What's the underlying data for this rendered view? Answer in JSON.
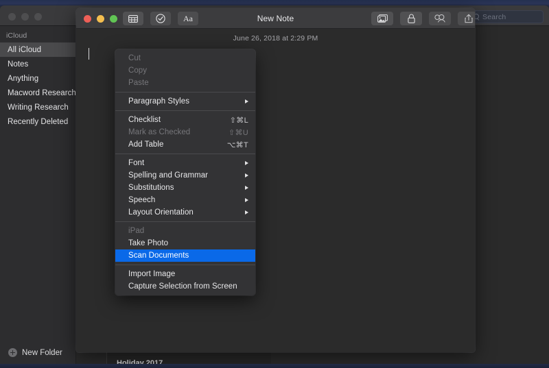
{
  "window_search": {
    "placeholder": "Search",
    "icon": "search-icon"
  },
  "sidebar": {
    "header": "iCloud",
    "items": [
      {
        "label": "All iCloud",
        "selected": true
      },
      {
        "label": "Notes",
        "selected": false
      },
      {
        "label": "Anything",
        "selected": false
      },
      {
        "label": "Macword Research",
        "selected": false
      },
      {
        "label": "Writing Research",
        "selected": false
      },
      {
        "label": "Recently Deleted",
        "selected": false
      }
    ],
    "new_folder_label": "New Folder",
    "new_folder_icon": "plus-circle-icon"
  },
  "notes_list": {
    "partial_note_title": "Holiday 2017"
  },
  "note_window": {
    "title": "New Note",
    "date": "June 26, 2018 at 2:29 PM",
    "body_text": "",
    "toolbar_left": [
      {
        "name": "table-button",
        "icon": "table-icon"
      },
      {
        "name": "checklist-button",
        "icon": "checkmark-circle-icon"
      },
      {
        "name": "format-button",
        "icon": "Aa"
      }
    ],
    "toolbar_right": [
      {
        "name": "media-button",
        "icon": "photo-icon"
      },
      {
        "name": "lock-button",
        "icon": "lock-icon"
      },
      {
        "name": "add-people-button",
        "icon": "add-person-icon"
      },
      {
        "name": "share-button",
        "icon": "share-icon"
      }
    ]
  },
  "context_menu": {
    "groups": [
      {
        "items": [
          {
            "label": "Cut",
            "shortcut": "",
            "disabled": true,
            "submenu": false,
            "highlighted": false
          },
          {
            "label": "Copy",
            "shortcut": "",
            "disabled": true,
            "submenu": false,
            "highlighted": false
          },
          {
            "label": "Paste",
            "shortcut": "",
            "disabled": true,
            "submenu": false,
            "highlighted": false
          }
        ]
      },
      {
        "items": [
          {
            "label": "Paragraph Styles",
            "shortcut": "",
            "disabled": false,
            "submenu": true,
            "highlighted": false
          }
        ]
      },
      {
        "items": [
          {
            "label": "Checklist",
            "shortcut": "⇧⌘L",
            "disabled": false,
            "submenu": false,
            "highlighted": false
          },
          {
            "label": "Mark as Checked",
            "shortcut": "⇧⌘U",
            "disabled": true,
            "submenu": false,
            "highlighted": false
          },
          {
            "label": "Add Table",
            "shortcut": "⌥⌘T",
            "disabled": false,
            "submenu": false,
            "highlighted": false
          }
        ]
      },
      {
        "items": [
          {
            "label": "Font",
            "shortcut": "",
            "disabled": false,
            "submenu": true,
            "highlighted": false
          },
          {
            "label": "Spelling and Grammar",
            "shortcut": "",
            "disabled": false,
            "submenu": true,
            "highlighted": false
          },
          {
            "label": "Substitutions",
            "shortcut": "",
            "disabled": false,
            "submenu": true,
            "highlighted": false
          },
          {
            "label": "Speech",
            "shortcut": "",
            "disabled": false,
            "submenu": true,
            "highlighted": false
          },
          {
            "label": "Layout Orientation",
            "shortcut": "",
            "disabled": false,
            "submenu": true,
            "highlighted": false
          }
        ]
      },
      {
        "items": [
          {
            "label": "iPad",
            "shortcut": "",
            "disabled": true,
            "submenu": false,
            "highlighted": false
          },
          {
            "label": "Take Photo",
            "shortcut": "",
            "disabled": false,
            "submenu": false,
            "highlighted": false
          },
          {
            "label": "Scan Documents",
            "shortcut": "",
            "disabled": false,
            "submenu": false,
            "highlighted": true
          }
        ]
      },
      {
        "items": [
          {
            "label": "Import Image",
            "shortcut": "",
            "disabled": false,
            "submenu": false,
            "highlighted": false
          },
          {
            "label": "Capture Selection from Screen",
            "shortcut": "",
            "disabled": false,
            "submenu": false,
            "highlighted": false
          }
        ]
      }
    ]
  },
  "colors": {
    "highlight_blue": "#0a69e8",
    "menu_bg": "#333335",
    "titlebar": "#3c3c3e",
    "note_bg": "#2b2b2b",
    "sidebar_bg": "#2d2d2f",
    "traffic_red": "#ee5f57",
    "traffic_yellow": "#f4be4f",
    "traffic_green": "#61c554"
  }
}
